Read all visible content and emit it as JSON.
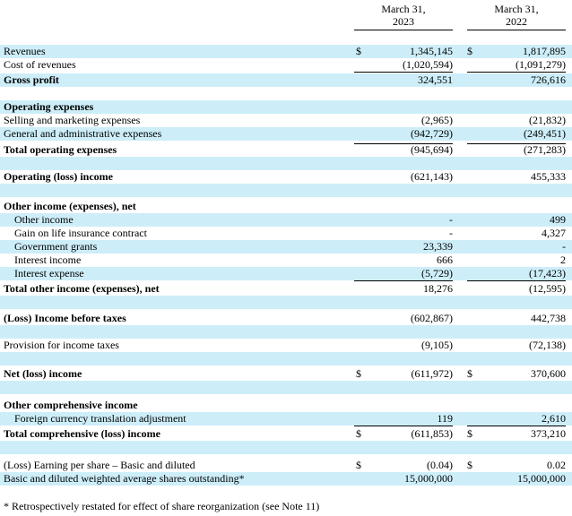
{
  "header": {
    "col1": [
      "March 31,",
      "2023"
    ],
    "col2": [
      "March 31,",
      "2022"
    ]
  },
  "rows": [
    {
      "label": "Revenues",
      "indent": 0,
      "bold": false,
      "shaded": true,
      "cur1": "$",
      "v1": "1,345,145",
      "cur2": "$",
      "v2": "1,817,895"
    },
    {
      "label": "Cost of revenues",
      "indent": 0,
      "bold": false,
      "shaded": false,
      "v1": "(1,020,594)",
      "v2": "(1,091,279)"
    },
    {
      "label": "Gross profit",
      "indent": 0,
      "bold": true,
      "shaded": true,
      "v1": "324,551",
      "v2": "726,616"
    },
    {
      "label": "",
      "indent": 0,
      "bold": false,
      "shaded": false
    },
    {
      "label": "Operating expenses",
      "indent": 0,
      "bold": true,
      "shaded": true
    },
    {
      "label": "Selling and marketing expenses",
      "indent": 0,
      "bold": false,
      "shaded": false,
      "v1": "(2,965)",
      "v2": "(21,832)"
    },
    {
      "label": "General and administrative expenses",
      "indent": 0,
      "bold": false,
      "shaded": true,
      "v1": "(942,729)",
      "v2": "(249,451)"
    },
    {
      "label": "Total operating expenses",
      "indent": 0,
      "bold": true,
      "shaded": false,
      "v1": "(945,694)",
      "v2": "(271,283)"
    },
    {
      "label": "",
      "indent": 0,
      "bold": false,
      "shaded": true
    },
    {
      "label": "Operating (loss) income",
      "indent": 0,
      "bold": true,
      "shaded": false,
      "v1": "(621,143)",
      "v2": "455,333"
    },
    {
      "label": "",
      "indent": 0,
      "bold": false,
      "shaded": true
    },
    {
      "label": "Other income (expenses), net",
      "indent": 0,
      "bold": true,
      "shaded": false
    },
    {
      "label": "Other income",
      "indent": 1,
      "bold": false,
      "shaded": true,
      "v1": "-",
      "v2": "499"
    },
    {
      "label": "Gain on life insurance contract",
      "indent": 1,
      "bold": false,
      "shaded": false,
      "v1": "-",
      "v2": "4,327"
    },
    {
      "label": "Government grants",
      "indent": 1,
      "bold": false,
      "shaded": true,
      "v1": "23,339",
      "v2": "-"
    },
    {
      "label": "Interest income",
      "indent": 1,
      "bold": false,
      "shaded": false,
      "v1": "666",
      "v2": "2"
    },
    {
      "label": "Interest expense",
      "indent": 1,
      "bold": false,
      "shaded": true,
      "v1": "(5,729)",
      "v2": "(17,423)"
    },
    {
      "label": "Total other income (expenses), net",
      "indent": 0,
      "bold": true,
      "shaded": false,
      "v1": "18,276",
      "v2": "(12,595)"
    },
    {
      "label": "",
      "indent": 0,
      "bold": false,
      "shaded": true
    },
    {
      "label": "(Loss) Income before taxes",
      "indent": 0,
      "bold": true,
      "shaded": false,
      "v1": "(602,867)",
      "v2": "442,738"
    },
    {
      "label": "",
      "indent": 0,
      "bold": false,
      "shaded": true
    },
    {
      "label": "Provision for income taxes",
      "indent": 0,
      "bold": false,
      "shaded": false,
      "v1": "(9,105)",
      "v2": "(72,138)"
    },
    {
      "label": "",
      "indent": 0,
      "bold": false,
      "shaded": true
    },
    {
      "label": "Net (loss) income",
      "indent": 0,
      "bold": true,
      "shaded": false,
      "cur1": "$",
      "v1": "(611,972)",
      "cur2": "$",
      "v2": "370,600"
    },
    {
      "label": "",
      "indent": 0,
      "bold": false,
      "shaded": true
    },
    {
      "label": "Other comprehensive income",
      "indent": 0,
      "bold": true,
      "shaded": false
    },
    {
      "label": "Foreign currency translation adjustment",
      "indent": 1,
      "bold": false,
      "shaded": true,
      "v1": "119",
      "v2": "2,610"
    },
    {
      "label": "Total comprehensive (loss) income",
      "indent": 0,
      "bold": true,
      "shaded": false,
      "cur1": "$",
      "v1": "(611,853)",
      "cur2": "$",
      "v2": "373,210"
    },
    {
      "label": "",
      "indent": 0,
      "bold": false,
      "shaded": true
    },
    {
      "label": "(Loss) Earning per share – Basic and diluted",
      "indent": 0,
      "bold": false,
      "shaded": false,
      "cur1": "$",
      "v1": "(0.04)",
      "cur2": "$",
      "v2": "0.02"
    },
    {
      "label": "Basic and diluted weighted average shares outstanding*",
      "indent": 0,
      "bold": false,
      "shaded": true,
      "v1": "15,000,000",
      "v2": "15,000,000"
    }
  ],
  "footnote": "* Retrospectively restated for effect of share reorganization (see Note 11)"
}
